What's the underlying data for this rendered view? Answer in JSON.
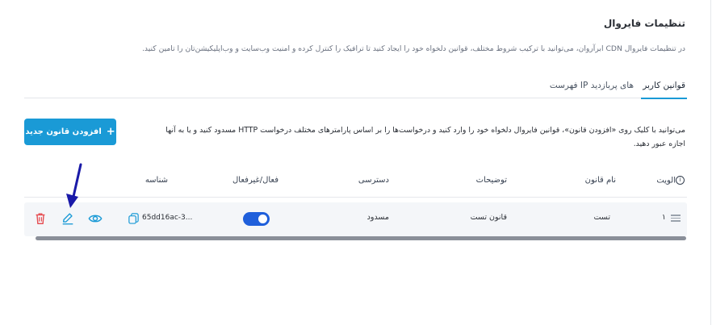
{
  "page": {
    "title": "تنظیمات فایروال",
    "description": "در تنظیمات فایروال CDN ابرآروان، می‌توانید با ترکیب شروط مختلف، قوانین دلخواه خود را ایجاد کنید تا ترافیک را کنترل کرده و امنیت وب‌سایت و وب‌اپلیکیشن‌تان را تامین کنید."
  },
  "tabs": [
    {
      "label": "قوانین کاربر",
      "active": true
    },
    {
      "label": "فهرست IP های پربازدید",
      "active": false
    }
  ],
  "add_button": {
    "label": "افزودن قانون جدید",
    "icon": "plus-icon"
  },
  "help": {
    "line1": "می‌توانید با کلیک روی «افزودن قانون»، قوانین فایروال دلخواه خود را وارد کنید و درخواست‌ها را بر اساس پارامترهای مختلف درخواست HTTP مسدود کنید و یا به آنها",
    "line2": "اجازه عبور دهید."
  },
  "table": {
    "headers": {
      "priority": "الویت",
      "name": "نام قانون",
      "description": "توضیحات",
      "access": "دسترسی",
      "status": "فعال/غیرفعال",
      "id": "شناسه"
    },
    "rows": [
      {
        "priority": "۱",
        "name": "تست",
        "description": "قانون تست",
        "access": "مسدود",
        "enabled": true,
        "id": "65dd16ac-3..."
      }
    ]
  },
  "colors": {
    "accent": "#1a9ad6",
    "toggle_on": "#1f5fdb",
    "delete": "#e5484d",
    "annotation_arrow": "#1a1aa8"
  }
}
